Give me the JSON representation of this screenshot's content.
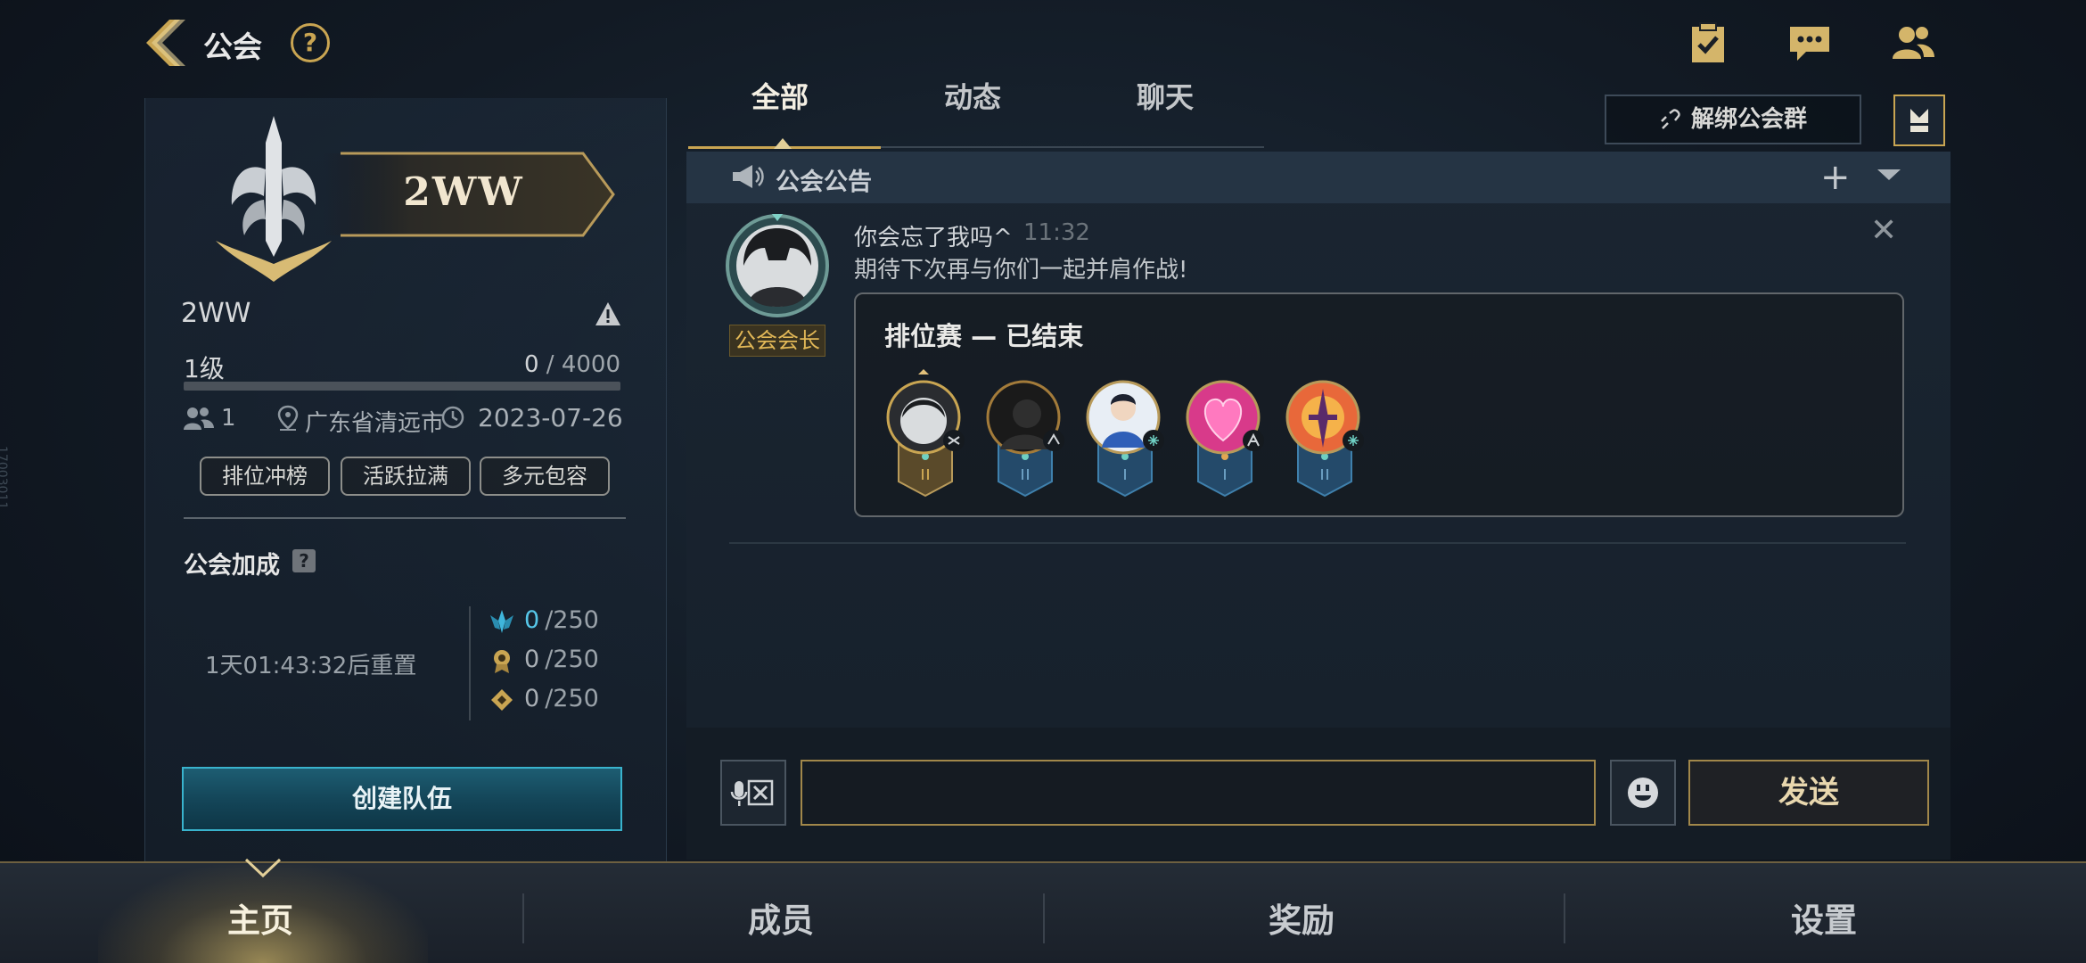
{
  "header": {
    "title": "公会",
    "help_label": "?"
  },
  "guild": {
    "banner_name": "2WW",
    "name": "2WW",
    "level": "1级",
    "exp_current": "0",
    "exp_max": " / 4000",
    "exp_progress": 0,
    "member_count": "1",
    "location": "广东省清远市",
    "founded_date": "2023-07-26",
    "tags": [
      "排位冲榜",
      "活跃拉满",
      "多元包容"
    ]
  },
  "bonus": {
    "title": "公会加成",
    "help_label": "?",
    "reset_text": "1天01:43:32后重置",
    "rows": [
      {
        "icon": "blue-crest-icon",
        "current": "0",
        "max": "/250"
      },
      {
        "icon": "gold-medal-icon",
        "current": "0",
        "max": "/250"
      },
      {
        "icon": "gold-diamond-icon",
        "current": "0",
        "max": "/250"
      }
    ]
  },
  "create_team_label": "创建队伍",
  "tabs": [
    "全部",
    "动态",
    "聊天"
  ],
  "unbind_label": "解绑公会群",
  "announcement": {
    "label": "公会公告",
    "add_label": "+"
  },
  "message": {
    "sender_name": "你会忘了我吗^",
    "time": "11:32",
    "text": "期待下次再与你们一起并肩作战!",
    "role_badge": "公会会长",
    "close_label": "✕",
    "card": {
      "title": "排位赛 — 已结束",
      "players": 5
    }
  },
  "input": {
    "value": "",
    "placeholder": ""
  },
  "send_label": "发送",
  "bottom_nav": [
    "主页",
    "成员",
    "奖励",
    "设置"
  ],
  "side_id": "17003011",
  "colors": {
    "gold": "#c9a552",
    "teal": "#39b3cd",
    "cyan_value": "#56c6e8"
  }
}
